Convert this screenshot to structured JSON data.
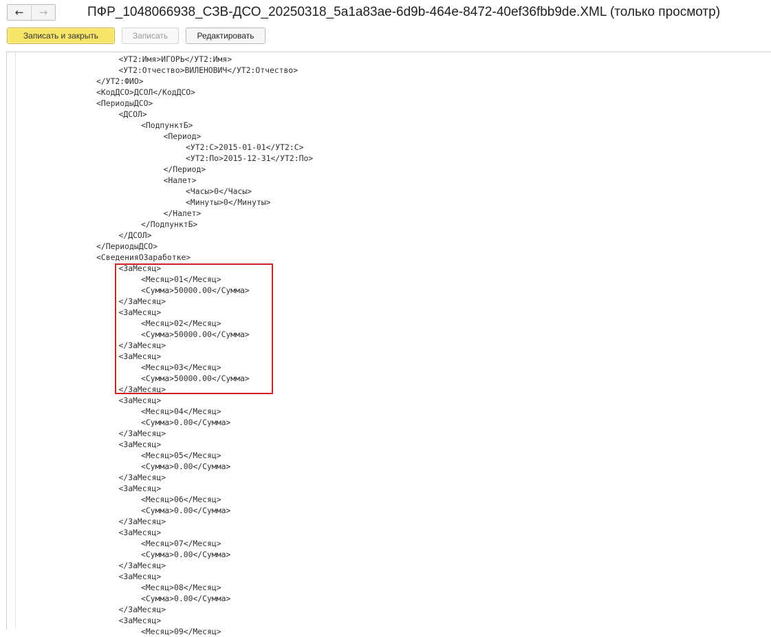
{
  "window": {
    "title": "ПФР_1048066938_СЗВ-ДСО_20250318_5a1a83ae-6d9b-464e-8472-40ef36fbb9de.XML (только просмотр)",
    "nav_back_icon": "arrow-left-icon",
    "nav_forward_icon": "arrow-right-icon",
    "nav_back_glyph": "←",
    "nav_forward_glyph": "→"
  },
  "toolbar": {
    "save_close_label": "Записать и закрыть",
    "save_label": "Записать",
    "edit_label": "Редактировать"
  },
  "colors": {
    "primary_button": "#f7e56a",
    "highlight_border": "#d01f25",
    "text": "#303030"
  },
  "code_lines": [
    {
      "indent": 2,
      "text": "<УТ2:Имя>ИГОРЬ</УТ2:Имя>"
    },
    {
      "indent": 2,
      "text": "<УТ2:Отчество>ВИЛЕНОВИЧ</УТ2:Отчество>"
    },
    {
      "indent": 1,
      "text": "</УТ2:ФИО>"
    },
    {
      "indent": 1,
      "text": "<КодДСО>ДСОЛ</КодДСО>"
    },
    {
      "indent": 1,
      "text": "<ПериодыДСО>"
    },
    {
      "indent": 2,
      "text": "<ДСОЛ>"
    },
    {
      "indent": 3,
      "text": "<ПодпунктБ>"
    },
    {
      "indent": 4,
      "text": "<Период>"
    },
    {
      "indent": 5,
      "text": "<УТ2:С>2015-01-01</УТ2:С>"
    },
    {
      "indent": 5,
      "text": "<УТ2:По>2015-12-31</УТ2:По>"
    },
    {
      "indent": 4,
      "text": "</Период>"
    },
    {
      "indent": 4,
      "text": "<Налет>"
    },
    {
      "indent": 5,
      "text": "<Часы>0</Часы>"
    },
    {
      "indent": 5,
      "text": "<Минуты>0</Минуты>"
    },
    {
      "indent": 4,
      "text": "</Налет>"
    },
    {
      "indent": 3,
      "text": "</ПодпунктБ>"
    },
    {
      "indent": 2,
      "text": "</ДСОЛ>"
    },
    {
      "indent": 1,
      "text": "</ПериодыДСО>"
    },
    {
      "indent": 1,
      "text": "<СведенияОЗаработке>"
    },
    {
      "indent": 2,
      "text": "<ЗаМесяц>"
    },
    {
      "indent": 3,
      "text": "<Месяц>01</Месяц>"
    },
    {
      "indent": 3,
      "text": "<Сумма>50000.00</Сумма>"
    },
    {
      "indent": 2,
      "text": "</ЗаМесяц>"
    },
    {
      "indent": 2,
      "text": "<ЗаМесяц>"
    },
    {
      "indent": 3,
      "text": "<Месяц>02</Месяц>"
    },
    {
      "indent": 3,
      "text": "<Сумма>50000.00</Сумма>"
    },
    {
      "indent": 2,
      "text": "</ЗаМесяц>"
    },
    {
      "indent": 2,
      "text": "<ЗаМесяц>"
    },
    {
      "indent": 3,
      "text": "<Месяц>03</Месяц>"
    },
    {
      "indent": 3,
      "text": "<Сумма>50000.00</Сумма>"
    },
    {
      "indent": 2,
      "text": "</ЗаМесяц>"
    },
    {
      "indent": 2,
      "text": "<ЗаМесяц>"
    },
    {
      "indent": 3,
      "text": "<Месяц>04</Месяц>"
    },
    {
      "indent": 3,
      "text": "<Сумма>0.00</Сумма>"
    },
    {
      "indent": 2,
      "text": "</ЗаМесяц>"
    },
    {
      "indent": 2,
      "text": "<ЗаМесяц>"
    },
    {
      "indent": 3,
      "text": "<Месяц>05</Месяц>"
    },
    {
      "indent": 3,
      "text": "<Сумма>0.00</Сумма>"
    },
    {
      "indent": 2,
      "text": "</ЗаМесяц>"
    },
    {
      "indent": 2,
      "text": "<ЗаМесяц>"
    },
    {
      "indent": 3,
      "text": "<Месяц>06</Месяц>"
    },
    {
      "indent": 3,
      "text": "<Сумма>0.00</Сумма>"
    },
    {
      "indent": 2,
      "text": "</ЗаМесяц>"
    },
    {
      "indent": 2,
      "text": "<ЗаМесяц>"
    },
    {
      "indent": 3,
      "text": "<Месяц>07</Месяц>"
    },
    {
      "indent": 3,
      "text": "<Сумма>0.00</Сумма>"
    },
    {
      "indent": 2,
      "text": "</ЗаМесяц>"
    },
    {
      "indent": 2,
      "text": "<ЗаМесяц>"
    },
    {
      "indent": 3,
      "text": "<Месяц>08</Месяц>"
    },
    {
      "indent": 3,
      "text": "<Сумма>0.00</Сумма>"
    },
    {
      "indent": 2,
      "text": "</ЗаМесяц>"
    },
    {
      "indent": 2,
      "text": "<ЗаМесяц>"
    },
    {
      "indent": 3,
      "text": "<Месяц>09</Месяц>"
    }
  ]
}
